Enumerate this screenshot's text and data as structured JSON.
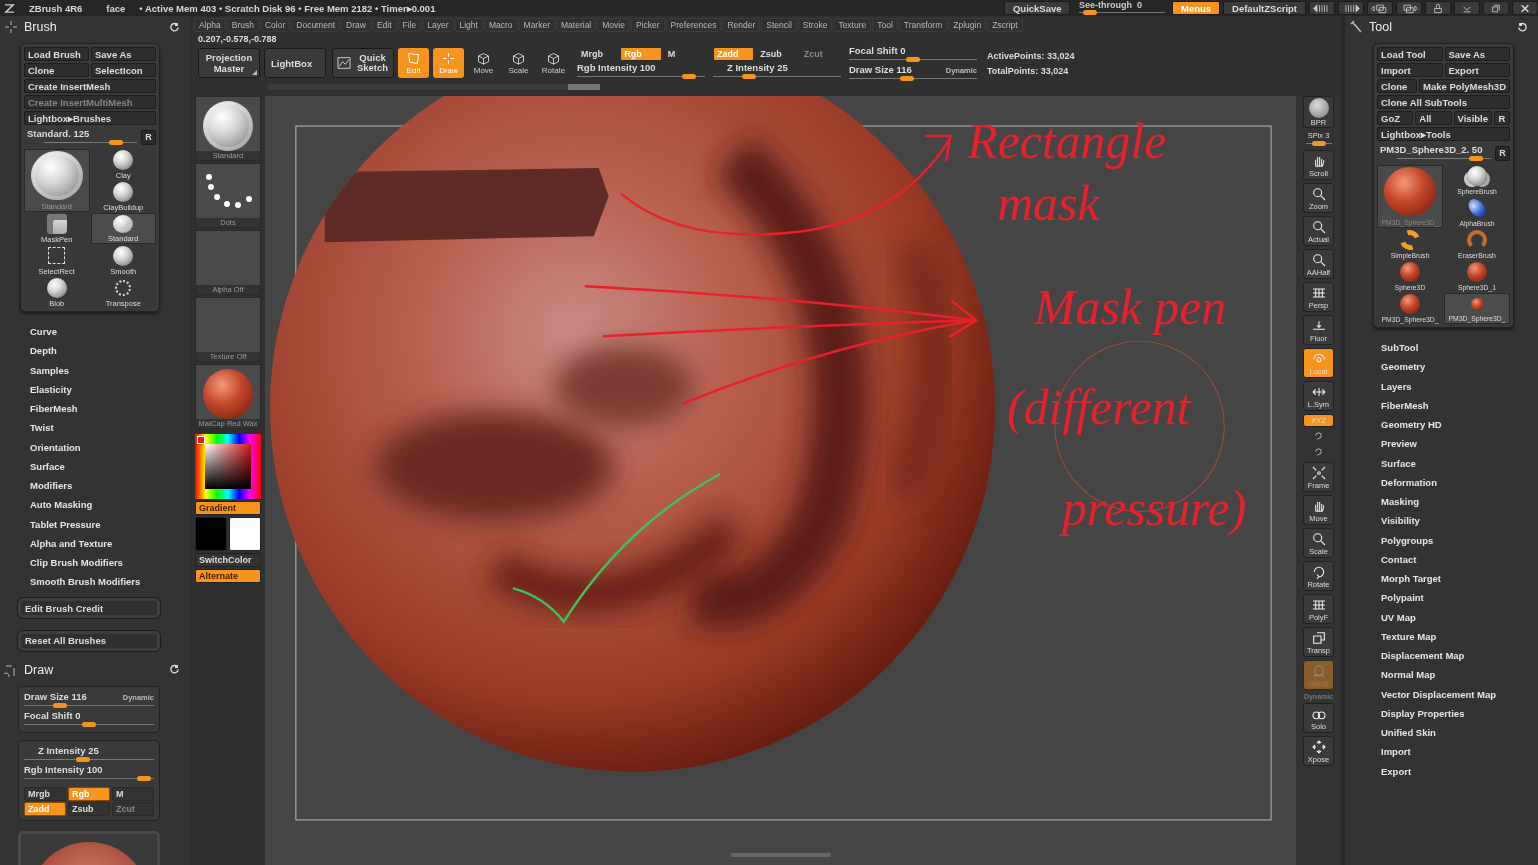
{
  "title_bar": {
    "app": "ZBrush 4R6",
    "document": "face",
    "stats": "• Active Mem 403 • Scratch Disk 96 • Free Mem 2182 • Timer▸0.001",
    "quicksave": "QuickSave",
    "see_through": {
      "label": "See-through",
      "value": "0",
      "level": 0.05
    },
    "menus": {
      "label": "Menus",
      "on": true
    },
    "script": "DefaultZScript"
  },
  "menu_bar": [
    "Alpha",
    "Brush",
    "Color",
    "Document",
    "Draw",
    "Edit",
    "File",
    "Layer",
    "Light",
    "Macro",
    "Marker",
    "Material",
    "Movie",
    "Picker",
    "Preferences",
    "Render",
    "Stencil",
    "Stroke",
    "Texture",
    "Tool",
    "Transform",
    "Zplugin",
    "Zscript"
  ],
  "coordinates": "0.207,-0.578,-0.788",
  "toolbar": {
    "projection_master": "Projection Master",
    "lightbox": "LightBox",
    "quick_sketch": "Quick Sketch",
    "modes": [
      {
        "label": "Edit",
        "kind": "edit",
        "on": true
      },
      {
        "label": "Draw",
        "kind": "draw",
        "on": true
      },
      {
        "label": "Move",
        "kind": "cube",
        "on": false
      },
      {
        "label": "Scale",
        "kind": "cube",
        "on": false
      },
      {
        "label": "Rotate",
        "kind": "cube",
        "on": false
      }
    ],
    "rgb_toggles": [
      {
        "label": "Mrgb",
        "on": false,
        "disabled": false
      },
      {
        "label": "Rgb",
        "on": true,
        "disabled": false
      },
      {
        "label": "M",
        "on": false,
        "disabled": false
      }
    ],
    "rgb_intensity": {
      "label": "Rgb Intensity",
      "value": "100",
      "level": 0.92
    },
    "z_toggles": [
      {
        "label": "Zadd",
        "on": true,
        "disabled": false
      },
      {
        "label": "Zsub",
        "on": false,
        "disabled": false
      },
      {
        "label": "Zcut",
        "on": false,
        "disabled": true
      }
    ],
    "z_intensity": {
      "label": "Z Intensity",
      "value": "25",
      "level": 0.25
    },
    "focal_shift": {
      "label": "Focal Shift",
      "value": "0",
      "level": 0.5
    },
    "draw_size": {
      "label": "Draw Size",
      "value": "116",
      "level": 0.45
    },
    "dynamic": "Dynamic",
    "active_points": "ActivePoints: 33,024",
    "total_points": "TotalPoints: 33,024"
  },
  "brush_panel": {
    "title": "Brush",
    "button_rows": [
      [
        {
          "label": "Load Brush",
          "disabled": false
        },
        {
          "label": "Save As",
          "disabled": false
        }
      ],
      [
        {
          "label": "Clone",
          "disabled": false
        },
        {
          "label": "SelectIcon",
          "disabled": false
        }
      ],
      [
        {
          "label": "Create InsertMesh",
          "disabled": false
        }
      ],
      [
        {
          "label": "Create InsertMultiMesh",
          "disabled": true
        }
      ],
      [
        {
          "label": "Lightbox▸Brushes",
          "disabled": false
        }
      ]
    ],
    "current": {
      "label": "Standard.",
      "value": "125",
      "level": 0.82,
      "reset": "R"
    },
    "current_thumb": {
      "label": "Standard",
      "kind": "swirl"
    },
    "brushes": [
      {
        "label": "Clay",
        "kind": "clay",
        "selected": false
      },
      {
        "label": "ClayBuildup",
        "kind": "clay",
        "selected": false
      },
      {
        "label": "MaskPen",
        "kind": "mask",
        "selected": false
      },
      {
        "label": "Standard",
        "kind": "swirl",
        "selected": true
      },
      {
        "label": "SelectRect",
        "kind": "rect",
        "selected": false
      },
      {
        "label": "Smooth",
        "kind": "clay",
        "selected": false
      },
      {
        "label": "Blob",
        "kind": "clay",
        "selected": false
      },
      {
        "label": "Transpose",
        "kind": "transpose",
        "selected": false
      }
    ],
    "sections": [
      "Curve",
      "Depth",
      "Samples",
      "Elasticity",
      "FiberMesh",
      "Twist",
      "Orientation",
      "Surface",
      "Modifiers",
      "Auto Masking",
      "Tablet Pressure",
      "Alpha and Texture",
      "Clip Brush Modifiers",
      "Smooth Brush Modifiers"
    ],
    "actions": [
      "Edit Brush Credit",
      "Reset All Brushes"
    ]
  },
  "draw_panel": {
    "title": "Draw",
    "draw_size": {
      "label": "Draw Size",
      "value": "116",
      "level": 0.25
    },
    "dynamic": "Dynamic",
    "focal_shift": {
      "label": "Focal Shift",
      "value": "0",
      "level": 0.5
    },
    "z_intensity": {
      "label": "Z Intensity",
      "value": "25",
      "level": 0.45
    },
    "rgb_intensity": {
      "label": "Rgb Intensity",
      "value": "100",
      "level": 0.97
    },
    "rgb_toggles": [
      {
        "label": "Mrgb",
        "on": false,
        "disabled": false
      },
      {
        "label": "Rgb",
        "on": true,
        "disabled": false
      },
      {
        "label": "M",
        "on": false,
        "disabled": false
      }
    ],
    "z_toggles": [
      {
        "label": "Zadd",
        "on": true,
        "disabled": false
      },
      {
        "label": "Zsub",
        "on": false,
        "disabled": false
      },
      {
        "label": "Zcut",
        "on": false,
        "disabled": true
      }
    ]
  },
  "left_shelf": {
    "items": [
      {
        "label": "Standard",
        "kind": "swirl"
      },
      {
        "label": "Dots",
        "kind": "dots"
      },
      {
        "label": "Alpha Off",
        "kind": "empty"
      },
      {
        "label": "Texture Off",
        "kind": "empty"
      },
      {
        "label": "MatCap Red Wax",
        "kind": "material"
      }
    ],
    "gradient": {
      "label": "Gradient",
      "on": true
    },
    "switch_color": "SwitchColor",
    "alternate": {
      "label": "Alternate",
      "on": true
    }
  },
  "canvas": {
    "annotations": [
      {
        "lines": [
          "Rectangle",
          "mask"
        ]
      },
      {
        "lines": [
          "Mask pen",
          "(different",
          "pressure)"
        ]
      }
    ]
  },
  "right_shelf": {
    "bpr": "BPR",
    "spix": {
      "label": "SPix 3",
      "level": 0.5
    },
    "items": [
      {
        "label": "Scroll",
        "kind": "hand",
        "on": false,
        "disabled": false
      },
      {
        "label": "Zoom",
        "kind": "magnifier",
        "on": false,
        "disabled": false
      },
      {
        "label": "Actual",
        "kind": "magnifier",
        "on": false,
        "disabled": false
      },
      {
        "label": "AAHalf",
        "kind": "magnifier",
        "on": false,
        "disabled": false
      },
      {
        "label": "Persp",
        "kind": "grid",
        "on": false,
        "disabled": false
      },
      {
        "label": "Floor",
        "kind": "floor",
        "on": false,
        "disabled": false
      },
      {
        "label": "Local",
        "kind": "local",
        "on": true,
        "disabled": false
      },
      {
        "label": "L.Sym",
        "kind": "sym",
        "on": false,
        "disabled": false
      },
      {
        "label": "XYZ",
        "kind": "xyz",
        "on": true,
        "disabled": false
      },
      {
        "kind": "rotate-small",
        "on": false,
        "disabled": false
      },
      {
        "kind": "rotate-small",
        "on": false,
        "disabled": false
      },
      {
        "label": "Frame",
        "kind": "frame",
        "on": false,
        "disabled": false
      },
      {
        "label": "Move",
        "kind": "hand",
        "on": false,
        "disabled": false
      },
      {
        "label": "Scale",
        "kind": "magnifier",
        "on": false,
        "disabled": false
      },
      {
        "label": "Rotate",
        "kind": "rotate",
        "on": false,
        "disabled": false
      },
      {
        "label": "PolyF",
        "kind": "grid",
        "on": false,
        "disabled": false
      },
      {
        "label": "Transp",
        "kind": "layers",
        "on": false,
        "disabled": false
      },
      {
        "label": "Ghost",
        "kind": "ghost",
        "on": true,
        "disabled": true
      }
    ],
    "dynamic": "Dynamic",
    "tail": [
      {
        "label": "Solo",
        "kind": "solo",
        "on": false,
        "disabled": false
      },
      {
        "label": "Xpose",
        "kind": "xpose",
        "on": false,
        "disabled": false
      }
    ]
  },
  "tool_panel": {
    "title": "Tool",
    "button_rows": [
      [
        {
          "label": "Load Tool",
          "disabled": false
        },
        {
          "label": "Save As",
          "disabled": false
        }
      ],
      [
        {
          "label": "Import",
          "disabled": false
        },
        {
          "label": "Export",
          "disabled": false
        }
      ],
      [
        {
          "label": "Clone",
          "disabled": false
        },
        {
          "label": "Make PolyMesh3D",
          "disabled": false
        }
      ],
      [
        {
          "label": "Clone All SubTools",
          "disabled": false
        }
      ],
      [
        {
          "label": "GoZ",
          "disabled": false
        },
        {
          "label": "All",
          "disabled": false
        },
        {
          "label": "Visible",
          "disabled": false
        },
        {
          "label": "R",
          "disabled": false
        }
      ],
      [
        {
          "label": "Lightbox▸Tools",
          "disabled": false
        }
      ]
    ],
    "current": {
      "label": "PM3D_Sphere3D_2.",
      "value": "50",
      "level": 0.9,
      "reset": "R"
    },
    "current_thumb": {
      "label": "PM3D_Sphere3D_",
      "kind": "red"
    },
    "tools": [
      {
        "label": "SphereBrush",
        "kind": "cluster",
        "selected": false
      },
      {
        "label": "AlphaBrush",
        "kind": "blue",
        "selected": false
      },
      {
        "label": "SimpleBrush",
        "kind": "s-shape",
        "selected": false
      },
      {
        "label": "EraserBrush",
        "kind": "ring",
        "selected": false
      },
      {
        "label": "Sphere3D",
        "kind": "red",
        "selected": false
      },
      {
        "label": "Sphere3D_1",
        "kind": "red",
        "selected": false
      },
      {
        "label": "PM3D_Sphere3D_",
        "kind": "red",
        "selected": false
      },
      {
        "label": "PM3D_Sphere3D_",
        "kind": "red-small",
        "selected": true
      }
    ],
    "sections": [
      "SubTool",
      "Geometry",
      "Layers",
      "FiberMesh",
      "Geometry HD",
      "Preview",
      "Surface",
      "Deformation",
      "Masking",
      "Visibility",
      "Polygroups",
      "Contact",
      "Morph Target",
      "Polypaint",
      "UV Map",
      "Texture Map",
      "Displacement Map",
      "Normal Map",
      "Vector Displacement Map",
      "Display Properties",
      "Unified Skin",
      "Import",
      "Export"
    ]
  }
}
